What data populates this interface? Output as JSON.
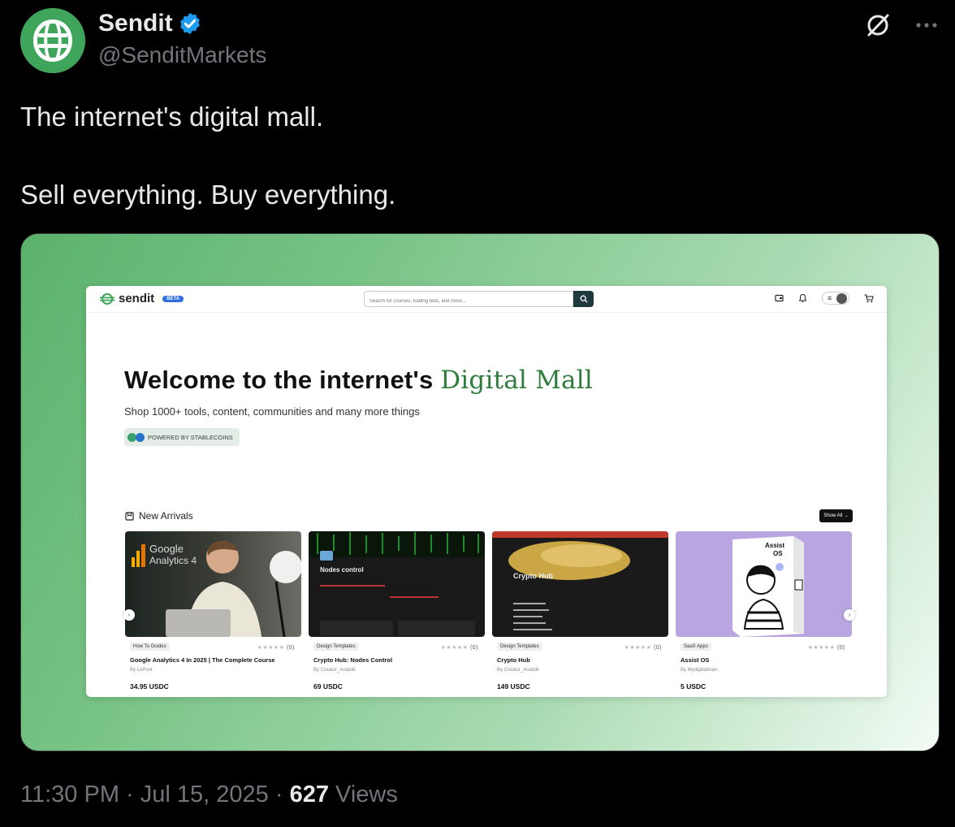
{
  "tweet": {
    "display_name": "Sendit",
    "handle": "@SenditMarkets",
    "text": "The internet's digital mall.\n\nSell everything. Buy everything.",
    "time": "11:30 PM",
    "date": "Jul 15, 2025",
    "views_count": "627",
    "views_label": "Views",
    "verified_color": "#1d9bf0",
    "avatar_color": "#3fa55a"
  },
  "site": {
    "logo_text": "sendit",
    "badge": "BETA",
    "search_placeholder": "Search for courses, trading bots, and more...",
    "hero_title": "Welcome to the internet's",
    "hero_accent": "Digital Mall",
    "hero_subtitle": "Shop 1000+ tools, content, communities and many more things",
    "powered_label": "POWERED BY STABLECOINS",
    "section_title": "New Arrivals",
    "show_all": "Show All →",
    "accent_color": "#2f7d3d",
    "cards": [
      {
        "category": "How To Guides",
        "stars": "★★★★★",
        "count": "(0)",
        "title": "Google Analytics 4 In 2025 | The Complete Course",
        "by": "By LePont",
        "price": "34.95 USDC",
        "thumb_text": "Google Analytics 4"
      },
      {
        "category": "Design Templates",
        "stars": "★★★★★",
        "count": "(0)",
        "title": "Crypto Hub: Nodes Control",
        "by": "By Creator_Anatolii",
        "price": "69 USDC",
        "thumb_text": "Nodes control"
      },
      {
        "category": "Design Templates",
        "stars": "★★★★★",
        "count": "(0)",
        "title": "Crypto Hub",
        "by": "By Creator_Anatolii",
        "price": "149 USDC",
        "thumb_text": "Crypto Hub"
      },
      {
        "category": "SaaS Apps",
        "stars": "★★★★★",
        "count": "(0)",
        "title": "Assist OS",
        "by": "By Mydigitalbrain",
        "price": "5 USDC",
        "thumb_text": "Assist OS"
      }
    ]
  }
}
